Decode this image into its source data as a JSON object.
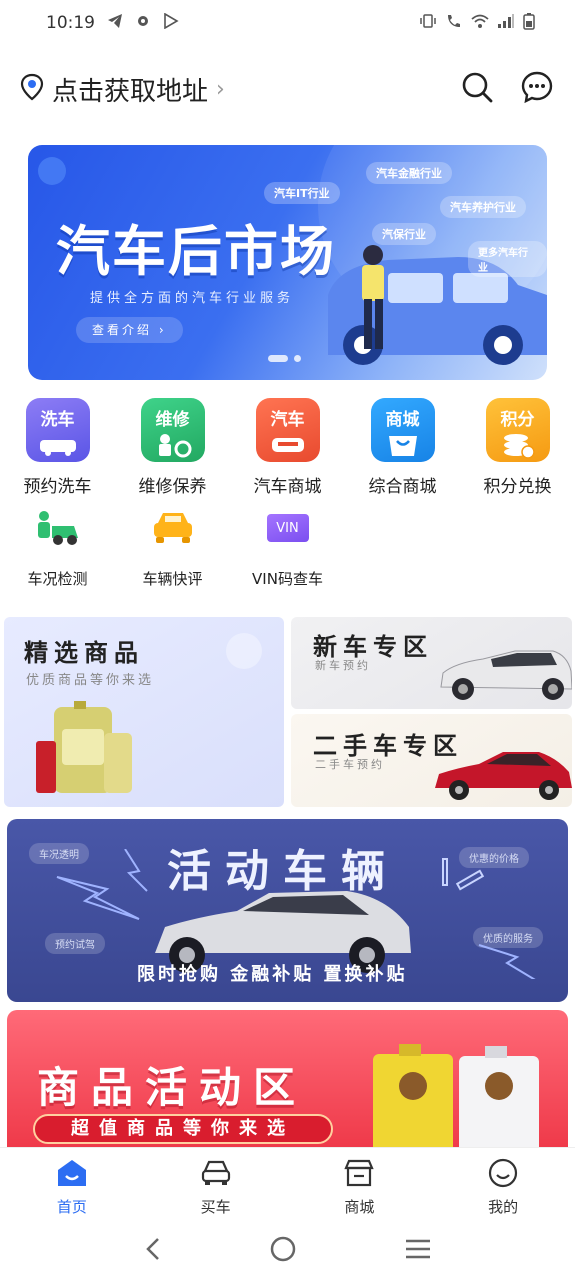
{
  "status_bar": {
    "time": "10:19"
  },
  "header": {
    "location_text": "点击获取地址"
  },
  "banner": {
    "title": "汽车后市场",
    "subtitle": "提供全方面的汽车行业服务",
    "button_label": "查看介绍 ›",
    "tags": [
      "汽车IT行业",
      "汽车金融行业",
      "汽车养护行业",
      "汽保行业",
      "更多汽车行业"
    ]
  },
  "services": {
    "row1": [
      {
        "icon_text": "洗车",
        "label": "预约洗车",
        "color": "#7b6bf0"
      },
      {
        "icon_text": "维修",
        "label": "维修保养",
        "color": "#2fbf71"
      },
      {
        "icon_text": "汽车",
        "label": "汽车商城",
        "color": "#f05a3a"
      },
      {
        "icon_text": "商城",
        "label": "综合商城",
        "color": "#2196f3"
      },
      {
        "icon_text": "积分",
        "label": "积分兑换",
        "color": "#f7a21b"
      }
    ],
    "row2": [
      {
        "label": "车况检测"
      },
      {
        "label": "车辆快评"
      },
      {
        "icon_text": "VIN",
        "label": "VIN码查车"
      }
    ]
  },
  "blocks": {
    "featured": {
      "title": "精选商品",
      "subtitle": "优质商品等你来选"
    },
    "new_car": {
      "title": "新车专区",
      "subtitle": "新车预约"
    },
    "used_car": {
      "title": "二手车专区",
      "subtitle": "二手车预约"
    }
  },
  "activity_vehicles": {
    "title": "活动车辆",
    "subtitle": "限时抢购 金融补贴 置换补贴",
    "pills": [
      "车况透明",
      "预约试驾",
      "优惠的价格",
      "优质的服务"
    ]
  },
  "goods_activity": {
    "title": "商品活动区",
    "subtitle": "超值商品等你来选"
  },
  "bottom_nav": [
    {
      "label": "首页",
      "active": true
    },
    {
      "label": "买车",
      "active": false
    },
    {
      "label": "商城",
      "active": false
    },
    {
      "label": "我的",
      "active": false
    }
  ],
  "colors": {
    "accent": "#2c6df2"
  }
}
